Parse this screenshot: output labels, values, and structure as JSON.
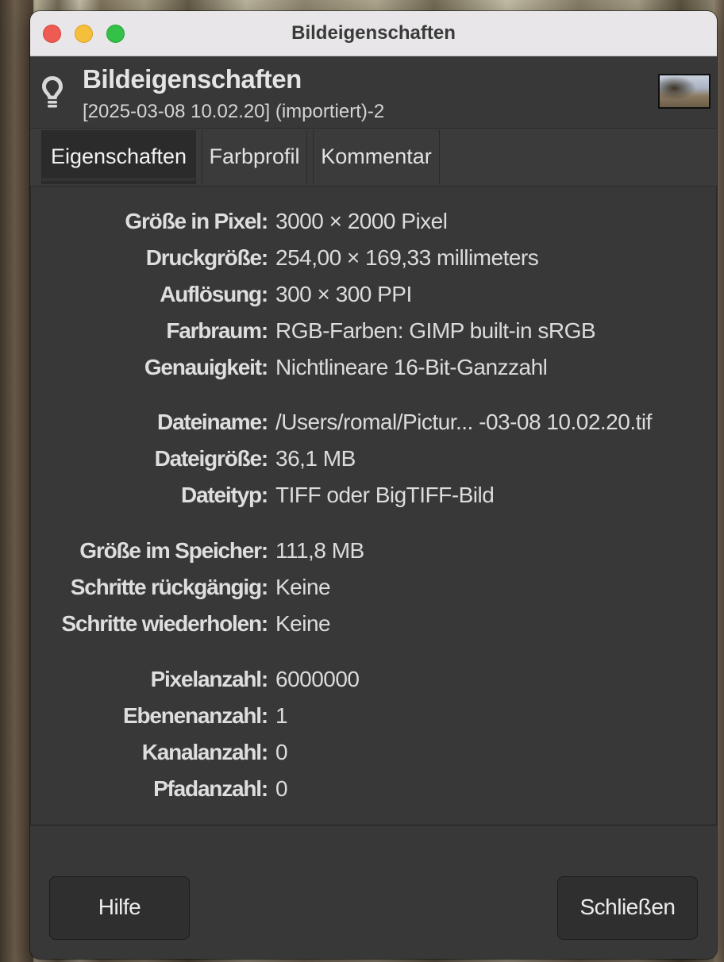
{
  "window": {
    "title": "Bildeigenschaften"
  },
  "header": {
    "title": "Bildeigenschaften",
    "subtitle": "[2025-03-08 10.02.20] (importiert)-2",
    "icon": "lightbulb-icon"
  },
  "tabs": [
    {
      "label": "Eigenschaften",
      "active": true
    },
    {
      "label": "Farbprofil",
      "active": false
    },
    {
      "label": "Kommentar",
      "active": false
    }
  ],
  "properties": [
    {
      "label": "Größe in Pixel:",
      "value": "3000 × 2000 Pixel"
    },
    {
      "label": "Druckgröße:",
      "value": "254,00 × 169,33 millimeters"
    },
    {
      "label": "Auflösung:",
      "value": "300 × 300 PPI"
    },
    {
      "label": "Farbraum:",
      "value": "RGB-Farben: GIMP built-in sRGB"
    },
    {
      "label": "Genauigkeit:",
      "value": "Nichtlineare 16-Bit-Ganzzahl"
    },
    {
      "label": "Dateiname:",
      "value": "/Users/romal/Pictur... -03-08 10.02.20.tif"
    },
    {
      "label": "Dateigröße:",
      "value": "36,1 MB"
    },
    {
      "label": "Dateityp:",
      "value": "TIFF oder BigTIFF-Bild"
    },
    {
      "label": "Größe im Speicher:",
      "value": "111,8 MB"
    },
    {
      "label": "Schritte rückgängig:",
      "value": "Keine"
    },
    {
      "label": "Schritte wiederholen:",
      "value": "Keine"
    },
    {
      "label": "Pixelanzahl:",
      "value": "6000000"
    },
    {
      "label": "Ebenenanzahl:",
      "value": "1"
    },
    {
      "label": "Kanalanzahl:",
      "value": "0"
    },
    {
      "label": "Pfadanzahl:",
      "value": "0"
    }
  ],
  "buttons": {
    "help": "Hilfe",
    "close": "Schließen"
  }
}
